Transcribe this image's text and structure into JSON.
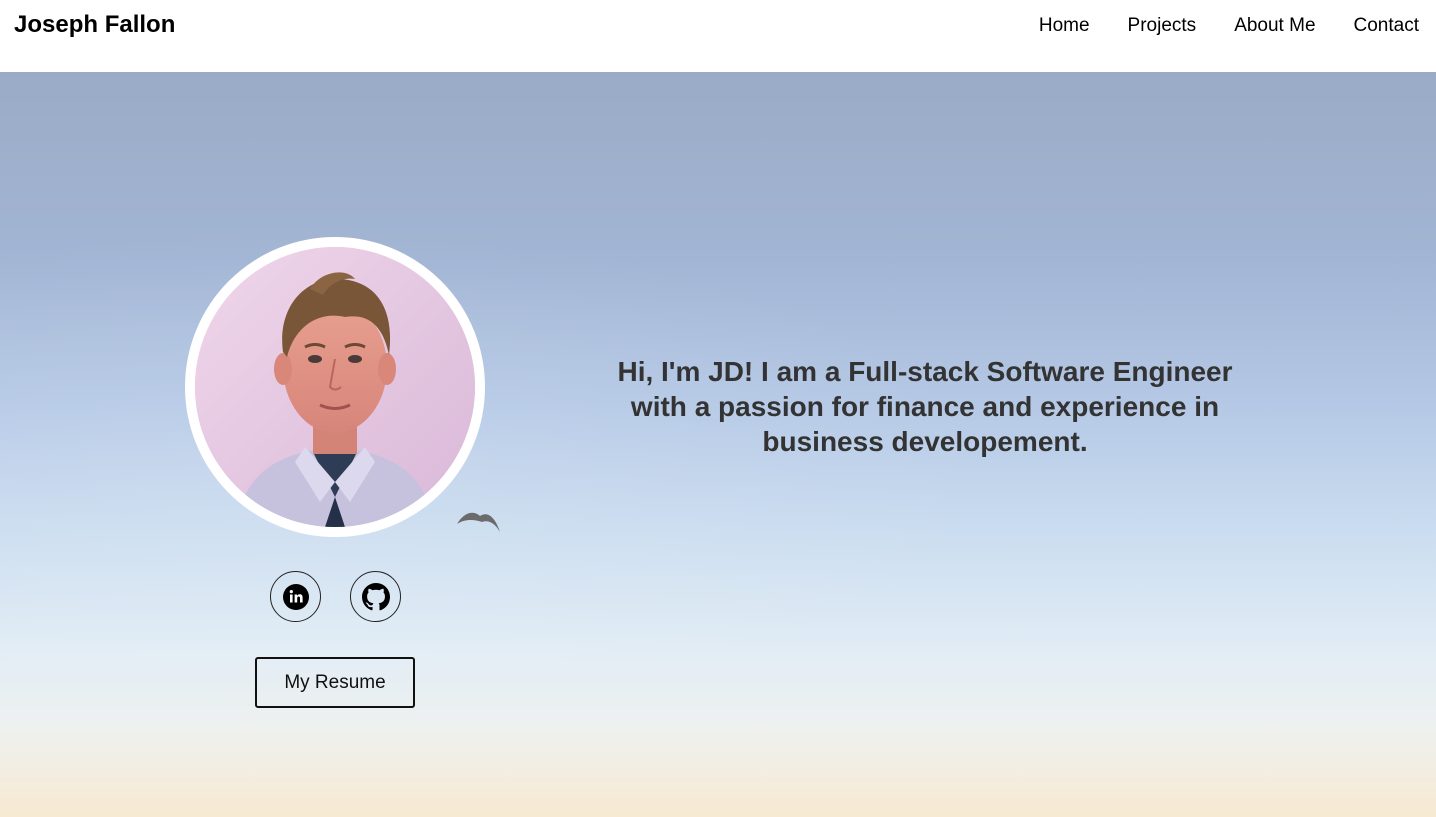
{
  "header": {
    "brand": "Joseph Fallon",
    "nav": [
      {
        "label": "Home"
      },
      {
        "label": "Projects"
      },
      {
        "label": "About Me"
      },
      {
        "label": "Contact"
      }
    ]
  },
  "hero": {
    "tagline": "Hi, I'm JD! I am a Full-stack Software Engineer with a passion for finance and experience in business developement.",
    "social": [
      {
        "icon": "linkedin-icon"
      },
      {
        "icon": "github-icon"
      }
    ],
    "resume_label": "My Resume"
  },
  "colors": {
    "text_dark": "#333333",
    "sky_top": "#9aabc6",
    "sky_bottom": "#f7e9d2"
  }
}
